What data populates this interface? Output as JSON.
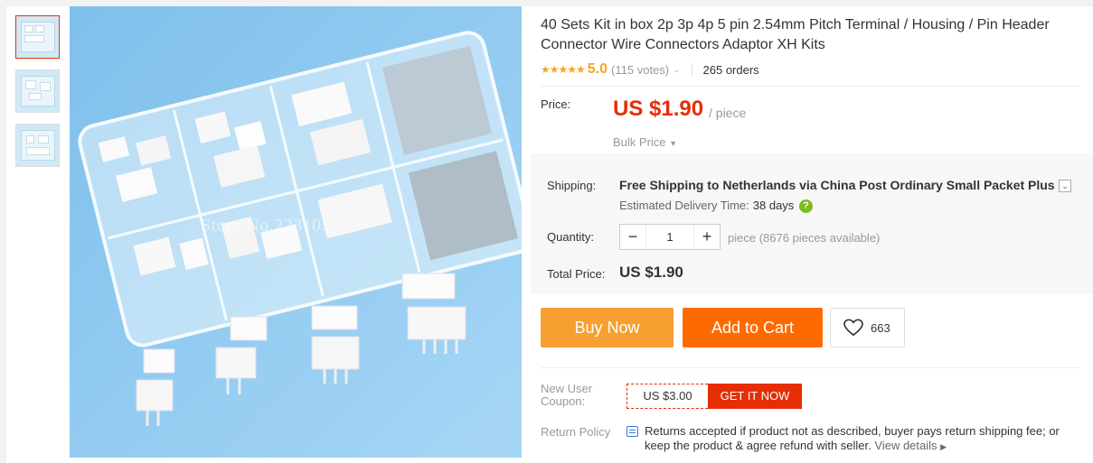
{
  "product": {
    "title": "40 Sets Kit in box 2p 3p 4p 5 pin 2.54mm Pitch Terminal / Housing / Pin Header Connector Wire Connectors Adaptor XH Kits",
    "watermark": "Store No.2231053"
  },
  "rating": {
    "stars": "★★★★★",
    "value": "5.0",
    "votes": "(115 votes)",
    "orders": "265 orders"
  },
  "price": {
    "label": "Price:",
    "amount": "US $1.90",
    "unit": "/ piece",
    "bulk_label": "Bulk Price"
  },
  "shipping": {
    "label": "Shipping:",
    "text": "Free Shipping to Netherlands via China Post Ordinary Small Packet Plus",
    "eta_label": "Estimated Delivery Time:",
    "eta_days": "38 days"
  },
  "quantity": {
    "label": "Quantity:",
    "minus": "−",
    "value": "1",
    "plus": "+",
    "available": "piece (8676 pieces available)"
  },
  "total": {
    "label": "Total Price:",
    "value": "US $1.90"
  },
  "actions": {
    "buy_now": "Buy Now",
    "add_to_cart": "Add to Cart",
    "wishlist_count": "663"
  },
  "coupon": {
    "label": "New User Coupon:",
    "amount": "US $3.00",
    "get_label": "GET IT NOW"
  },
  "return_policy": {
    "label": "Return Policy",
    "text": "Returns accepted if product not as described, buyer pays return shipping fee; or keep the product & agree refund with seller.",
    "view_details": "View details"
  },
  "colors": {
    "accent": "#e62e04",
    "buy_now": "#f5a030",
    "add_to_cart": "#ff6a00",
    "star": "#f5a623"
  }
}
